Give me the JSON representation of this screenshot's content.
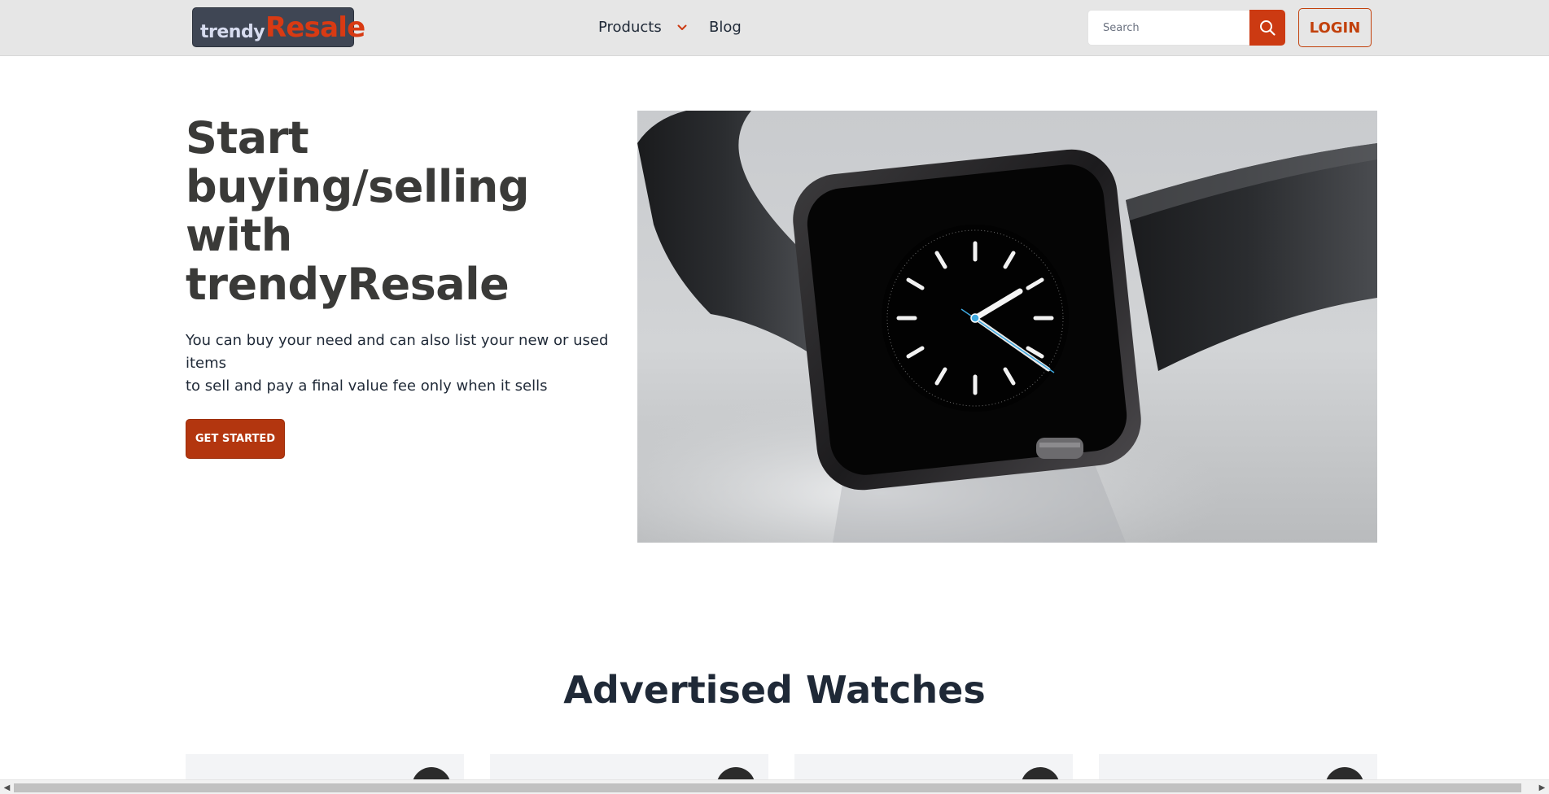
{
  "nav": {
    "logo_part1": "trendy",
    "logo_part2": "Resale",
    "products_label": "Products",
    "blog_label": "Blog",
    "search_placeholder": "Search",
    "login_label": "LOGIN"
  },
  "hero": {
    "title": "Start buying/selling with trendyResale",
    "description_line1": "You can buy your need and can also list your new or used items",
    "description_line2": "to sell and pay a final value fee only when it sells",
    "cta_label": "GET STARTED",
    "image_icon": "smartwatch-photo"
  },
  "section": {
    "title": "Advertised Watches",
    "cards": [
      {
        "name": "product-card-1"
      },
      {
        "name": "product-card-2"
      },
      {
        "name": "product-card-3"
      },
      {
        "name": "product-card-4"
      }
    ]
  },
  "colors": {
    "accent": "#cc3a12",
    "navbar_bg": "#e6e6e6",
    "logo_bg": "#3f4654",
    "heading": "#3a3a38"
  }
}
